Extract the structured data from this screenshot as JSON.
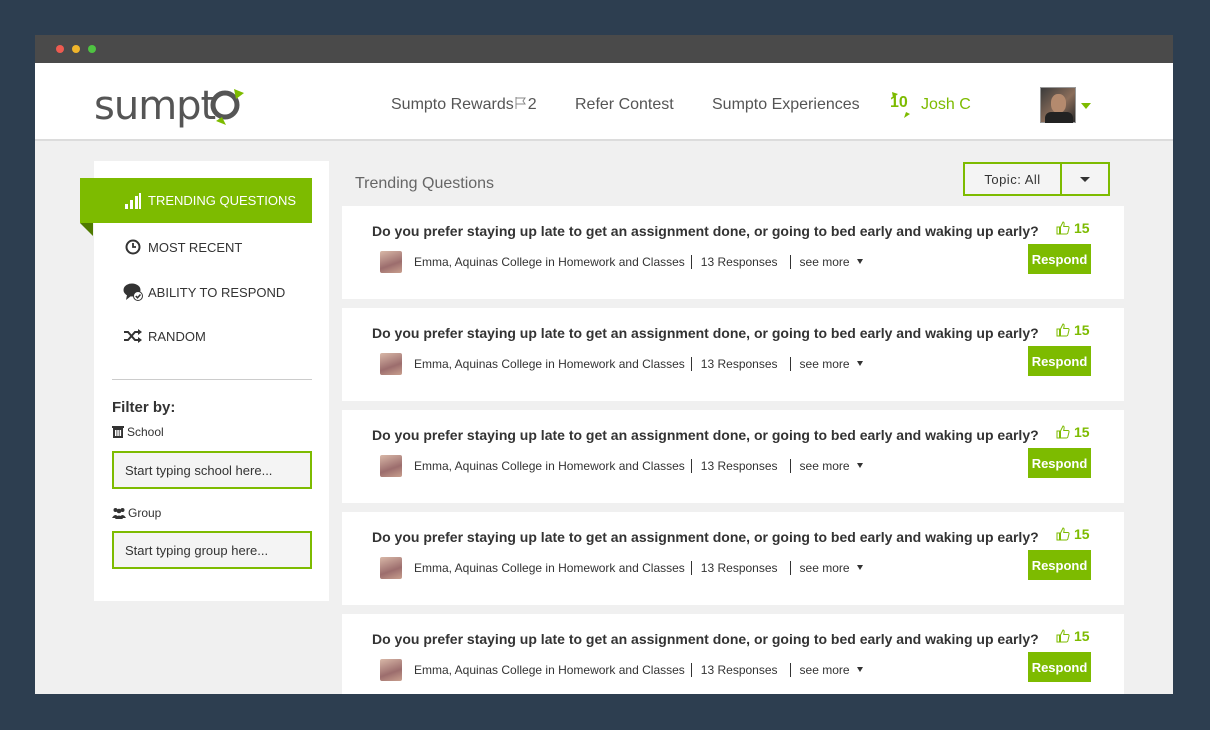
{
  "brand": {
    "name": "sumpto",
    "accent": "#7dbb00"
  },
  "nav": {
    "rewards_label": "Sumpto Rewards",
    "rewards_count": "2",
    "refer_label": "Refer Contest",
    "experiences_label": "Sumpto Experiences",
    "user_points": "10",
    "user_name": "Josh C"
  },
  "sidebar": {
    "items": [
      {
        "label": "TRENDING QUESTIONS",
        "icon": "bar-chart-icon"
      },
      {
        "label": "MOST RECENT",
        "icon": "clock-icon"
      },
      {
        "label": "ABILITY TO RESPOND",
        "icon": "chat-check-icon"
      },
      {
        "label": "RANDOM",
        "icon": "shuffle-icon"
      }
    ],
    "filter_title": "Filter by:",
    "school_label": "School",
    "school_placeholder": "Start typing school here...",
    "group_label": "Group",
    "group_placeholder": "Start typing group here..."
  },
  "main": {
    "title": "Trending Questions",
    "topic_label": "Topic: All"
  },
  "questions": [
    {
      "text": "Do you prefer staying up late to get an assignment done, or going to bed early and waking up early?",
      "author": "Emma, Aquinas College in Homework and Classes",
      "responses": "13 Responses",
      "see_more": "see more",
      "likes": "15",
      "respond": "Respond"
    },
    {
      "text": "Do you prefer staying up late to get an assignment done, or going to bed early and waking up early?",
      "author": "Emma, Aquinas College in Homework and Classes",
      "responses": "13 Responses",
      "see_more": "see more",
      "likes": "15",
      "respond": "Respond"
    },
    {
      "text": "Do you prefer staying up late to get an assignment done, or going to bed early and waking up early?",
      "author": "Emma, Aquinas College in Homework and Classes",
      "responses": "13 Responses",
      "see_more": "see more",
      "likes": "15",
      "respond": "Respond"
    },
    {
      "text": "Do you prefer staying up late to get an assignment done, or going to bed early and waking up early?",
      "author": "Emma, Aquinas College in Homework and Classes",
      "responses": "13 Responses",
      "see_more": "see more",
      "likes": "15",
      "respond": "Respond"
    },
    {
      "text": "Do you prefer staying up late to get an assignment done, or going to bed early and waking up early?",
      "author": "Emma, Aquinas College in Homework and Classes",
      "responses": "13 Responses",
      "see_more": "see more",
      "likes": "15",
      "respond": "Respond"
    }
  ]
}
